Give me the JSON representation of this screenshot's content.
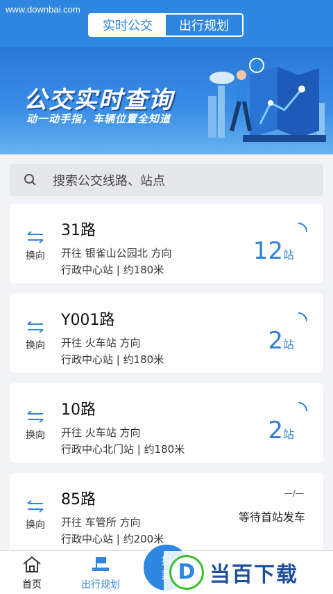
{
  "watermark": "www.downbai.com",
  "segment": {
    "realtime": "实时公交",
    "planning": "出行规划"
  },
  "banner": {
    "title": "公交实时查询",
    "subtitle": "动一动手指，车辆位置全知道"
  },
  "search": {
    "placeholder": "搜索公交线路、站点"
  },
  "swap_label": "换向",
  "routes": [
    {
      "name": "31路",
      "direction": "开往 银雀山公园北 方向",
      "stop": "行政中心站 | 约180米",
      "eta_num": "12",
      "eta_unit": "站"
    },
    {
      "name": "Y001路",
      "direction": "开往 火车站 方向",
      "stop": "行政中心站 | 约180米",
      "eta_num": "2",
      "eta_unit": "站"
    },
    {
      "name": "10路",
      "direction": "开往 火车站 方向",
      "stop": "行政中心北门站 | 约180米",
      "eta_num": "2",
      "eta_unit": "站"
    },
    {
      "name": "85路",
      "direction": "开往 车管所 方向",
      "stop": "行政中心站 | 约200米",
      "status": "等待首站发车",
      "dash": "—/—"
    }
  ],
  "tabs": {
    "home": "首页",
    "planning": "出行规划",
    "scan_top": "扫",
    "scan_bottom": "乘"
  },
  "logo": {
    "letter": "D",
    "text": "当百下载"
  },
  "colors": {
    "primary": "#2f86e0",
    "eta": "#2f7fd6"
  }
}
